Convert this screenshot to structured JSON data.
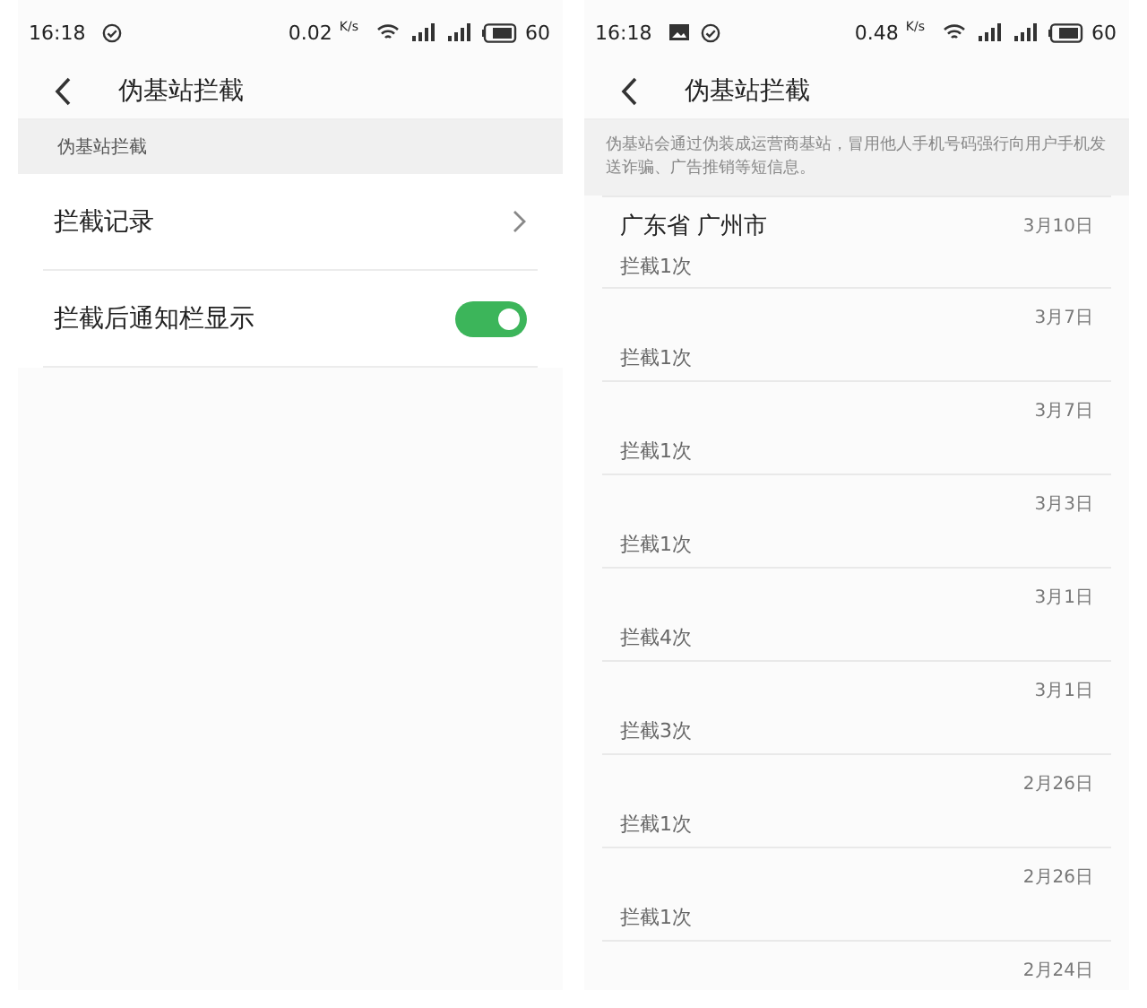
{
  "screens": [
    {
      "status_bar": {
        "time": "16:18",
        "icons": [
          {
            "kind": "check"
          }
        ],
        "speed": "0.02",
        "speed_unit": "K/s",
        "battery": "60"
      },
      "header": {
        "title": "伪基站拦截"
      },
      "kind": "settings",
      "section_title": "伪基站拦截",
      "rows": [
        {
          "kind": "link",
          "label": "拦截记录"
        },
        {
          "kind": "switch",
          "label": "拦截后通知栏显示",
          "on": true
        }
      ]
    },
    {
      "status_bar": {
        "time": "16:18",
        "icons": [
          {
            "kind": "image"
          },
          {
            "kind": "check"
          }
        ],
        "speed": "0.48",
        "speed_unit": "K/s",
        "battery": "60"
      },
      "header": {
        "title": "伪基站拦截"
      },
      "kind": "records",
      "description": "伪基站会通过伪装成运营商基站，冒用他人手机号码强行向用户手机发送诈骗、广告推销等短信息。",
      "records": [
        {
          "location": "广东省 广州市",
          "date": "3月10日",
          "count": "拦截1次"
        },
        {
          "date": "3月7日",
          "count": "拦截1次"
        },
        {
          "date": "3月7日",
          "count": "拦截1次"
        },
        {
          "date": "3月3日",
          "count": "拦截1次"
        },
        {
          "date": "3月1日",
          "count": "拦截4次"
        },
        {
          "date": "3月1日",
          "count": "拦截3次"
        },
        {
          "date": "2月26日",
          "count": "拦截1次"
        },
        {
          "date": "2月26日",
          "count": "拦截1次"
        },
        {
          "date": "2月24日"
        }
      ]
    }
  ]
}
